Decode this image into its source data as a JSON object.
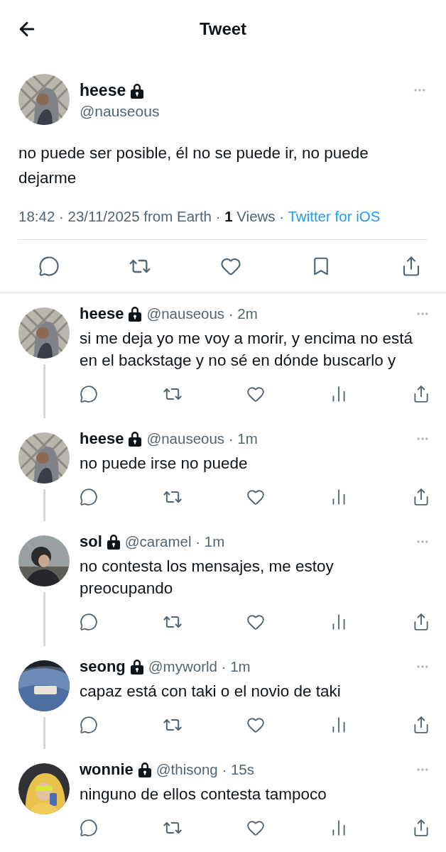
{
  "header": {
    "title": "Tweet"
  },
  "tweet": {
    "name": "heese",
    "protected": true,
    "handle": "@nauseous",
    "text": "no puede ser posible, él no se puede ir, no puede dejarme",
    "meta": "18:42 · 23/11/2025 from Earth · **1** Views · ",
    "source": "Twitter for iOS"
  },
  "replies": [
    {
      "name": "heese",
      "protected": true,
      "handle_line": "@nauseous · 2m",
      "text": "si me deja yo me voy a morir, y encima no está en el backstage y no sé en dónde buscarlo y",
      "thread_continues": true
    },
    {
      "name": "heese",
      "protected": true,
      "handle_line": "@nauseous · 1m",
      "text": "no puede irse no puede",
      "thread_continues": true
    },
    {
      "name": "sol",
      "protected": true,
      "handle_line": "@caramel · 1m",
      "text": "no contesta los mensajes, me estoy preocupando",
      "thread_continues": true
    },
    {
      "name": "seong",
      "protected": true,
      "handle_line": "@myworld · 1m",
      "text": "capaz está con taki o el novio de taki",
      "thread_continues": true
    },
    {
      "name": "wonnie",
      "protected": true,
      "handle_line": "@thisong · 15s",
      "text": "ninguno de ellos contesta tampoco",
      "thread_continues": false
    }
  ]
}
